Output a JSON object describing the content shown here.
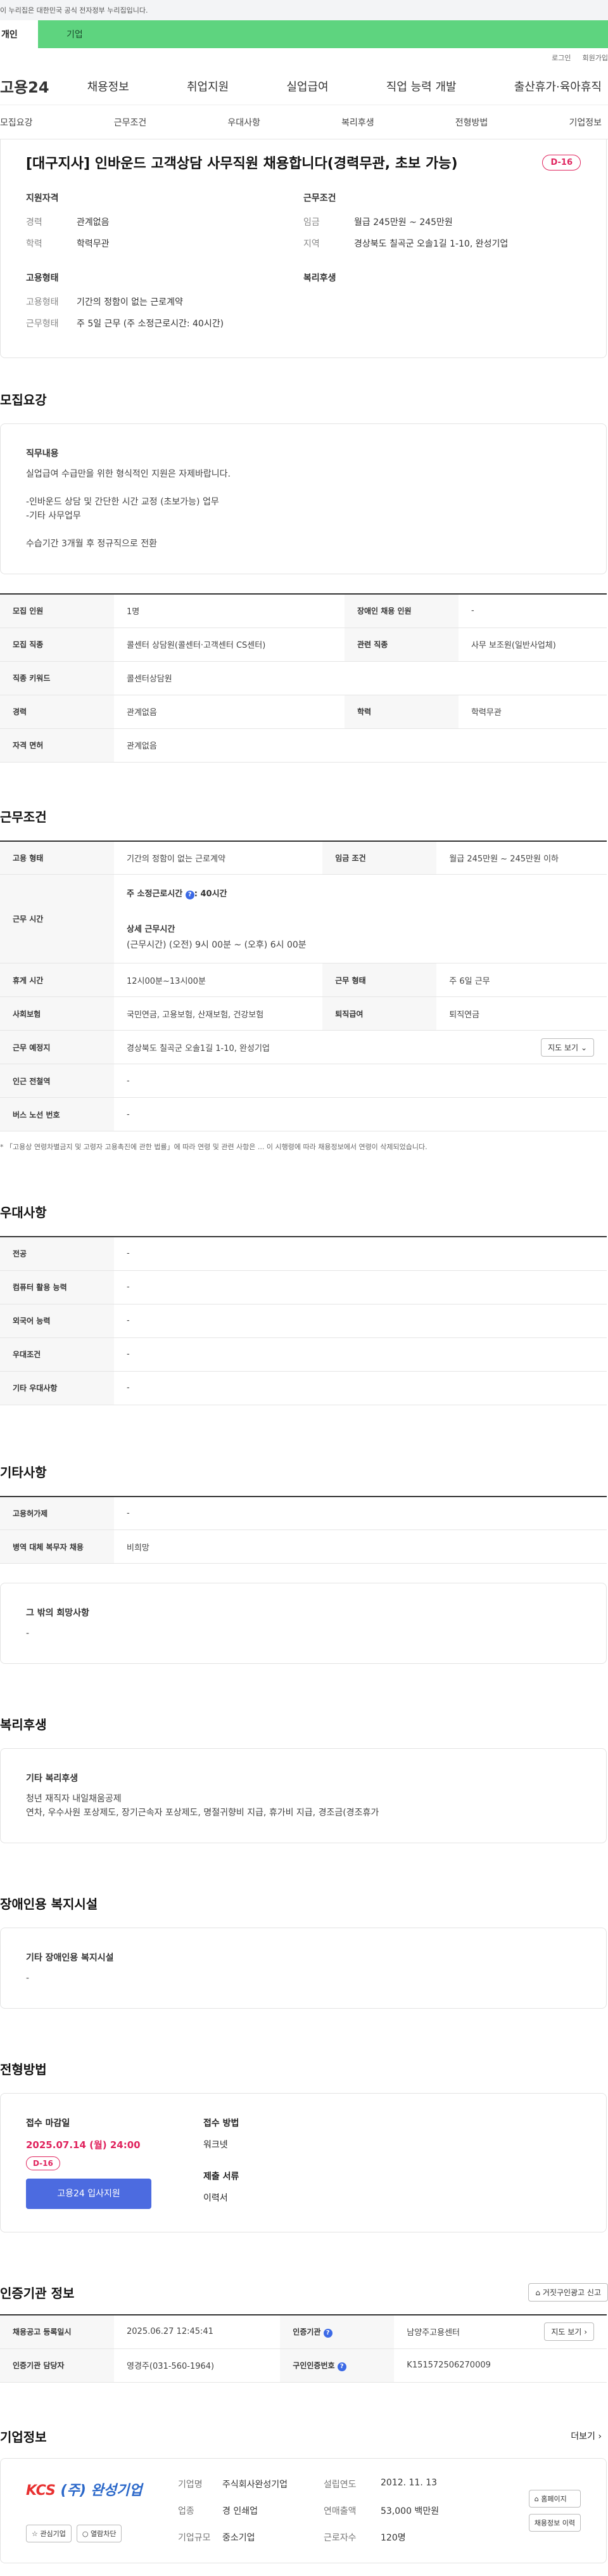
{
  "gov_banner": "이 누리집은 대한민국 공식 전자정부 누리집입니다.",
  "top_tabs": [
    "개인",
    "기업"
  ],
  "util_links": [
    "로그인",
    "회원가입"
  ],
  "logo": "고용24",
  "gnb": [
    "채용정보",
    "취업지원",
    "실업급여",
    "직업 능력 개발",
    "출산휴가·육아휴직"
  ],
  "subnav": [
    "모집요강",
    "근무조건",
    "우대사항",
    "복리후생",
    "전형방법",
    "기업정보"
  ],
  "title_box": {
    "title": "[대구지사] 인바운드 고객상담 사무직원 채용합니다(경력무관, 초보 가능)",
    "dday": "D-16",
    "qual_label": "지원자격",
    "qual": [
      {
        "k": "경력",
        "v": "관계없음"
      },
      {
        "k": "학력",
        "v": "학력무관"
      }
    ],
    "cond_label": "근무조건",
    "cond": [
      {
        "k": "임금",
        "v": "월급 245만원 ~ 245만원"
      },
      {
        "k": "지역",
        "v": "경상북도 칠곡군 오솔1길 1-10, 완성기업"
      }
    ],
    "emp_label": "고용형태",
    "emp": [
      {
        "k": "고용형태",
        "v": "기간의 정함이 없는 근로계약"
      },
      {
        "k": "근무형태",
        "v": "주 5일 근무 (주 소정근로시간: 40시간)"
      }
    ],
    "welfare_label": "복리후생"
  },
  "recruit": {
    "heading": "모집요강",
    "job_label": "직무내용",
    "job_lines": [
      "실업급여 수급만을 위한 형식적인 지원은 자제바랍니다.",
      "",
      "-인바운드 상담 및 간단한 시간 교정 (초보가능) 업무",
      "-기타 사무업무",
      "",
      "수습기간 3개월 후 정규직으로 전환"
    ],
    "rows": [
      [
        "모집 인원",
        "1명",
        "장애인 채용 인원",
        "-"
      ],
      [
        "모집 직종",
        "콜센터 상담원(콜센터·고객센터 CS센터)",
        "관련 직종",
        "사무 보조원(일반사업체)"
      ],
      [
        "직종 키워드",
        "콜센터상담원"
      ],
      [
        "경력",
        "관계없음",
        "학력",
        "학력무관"
      ],
      [
        "자격 면허",
        "관계없음"
      ]
    ]
  },
  "work": {
    "heading": "근무조건",
    "emp_type_k": "고용 형태",
    "emp_type_v": "기간의 정함이 없는 근로계약",
    "wage_k": "임금 조건",
    "wage_v": "월급 245만원 ~ 245만원 이하",
    "hours_k": "근무 시간",
    "hours_title": "주 소정근로시간",
    "hours_val": ": 40시간",
    "detail_title": "상세 근무시간",
    "detail_val": "(근무시간) (오전) 9시 00분 ~ (오후) 6시 00분",
    "break_k": "휴게 시간",
    "break_v": "12시00분~13시00분",
    "form_k": "근무 형태",
    "form_v": "주 6일 근무",
    "ins_k": "사회보험",
    "ins_v": "국민연금, 고용보험, 산재보험, 건강보험",
    "ret_k": "퇴직급여",
    "ret_v": "퇴직연금",
    "place_k": "근무 예정지",
    "place_v": "경상북도 칠곡군 오솔1길 1-10, 완성기업",
    "map_btn": "지도 보기",
    "subway_k": "인근 전철역",
    "subway_v": "-",
    "bus_k": "버스 노선 번호",
    "bus_v": "-",
    "note": "* 「고용상 연령차별금지 및 고령자 고용촉진에 관한 법률」에 따라 연령 및 관련 사항은 ... 이 시행령에 따라 채용정보에서 연령이 삭제되었습니다."
  },
  "pref": {
    "heading": "우대사항",
    "rows": [
      [
        "전공",
        "-"
      ],
      [
        "컴퓨터 활용 능력",
        "-"
      ],
      [
        "외국어 능력",
        "-"
      ],
      [
        "우대조건",
        "-"
      ],
      [
        "기타 우대사항",
        "-"
      ]
    ]
  },
  "etc": {
    "heading": "기타사항",
    "rows": [
      [
        "고용허가제",
        "-"
      ],
      [
        "병역 대체 복무자 채용",
        "비희망"
      ]
    ],
    "other_label": "그 밖의 희망사항",
    "other_val": "-"
  },
  "welfare": {
    "heading": "복리후생",
    "label": "기타 복리후생",
    "line1": "청년 재직자 내일채움공제",
    "line2": "연차, 우수사원 포상제도, 장기근속자 포상제도, 명절귀향비 지급, 휴가비 지급, 경조금(경조휴가"
  },
  "disability": {
    "heading": "장애인용 복지시설",
    "label": "기타 장애인용 복지시설",
    "val": "-"
  },
  "apply": {
    "heading": "전형방법",
    "deadline_label": "접수 마감일",
    "deadline": "2025.07.14 (월) 24:00",
    "dday": "D-16",
    "btn": "고용24 입사지원",
    "method_label": "접수 방법",
    "method": "워크넷",
    "docs_label": "제출 서류",
    "docs": "이력서"
  },
  "cert": {
    "heading": "인증기관 정보",
    "report_btn": "거짓구인광고 신고",
    "reg_date_k": "채용공고 등록일시",
    "reg_date_v": "2025.06.27 12:45:41",
    "org_k": "인증기관",
    "org_v": "남양주고용센터",
    "map_btn": "지도 보기",
    "mgr_k": "인증기관 담당자",
    "mgr_v": "영경주(031-560-1964)",
    "no_k": "구인인증번호",
    "no_v": "K151572506270009"
  },
  "company": {
    "heading": "기업정보",
    "more": "더보기",
    "logo_mark": "KCS",
    "logo_name": "(주) 완성기업",
    "fav_btn": "관심기업",
    "block_btn": "열람차단",
    "info": [
      [
        "기업명",
        "주식회사완성기업",
        "설립연도",
        "2012. 11. 13"
      ],
      [
        "업종",
        "경 인쇄업",
        "연매출액",
        "53,000 백만원"
      ],
      [
        "기업규모",
        "중소기업",
        "근로자수",
        "120명"
      ]
    ],
    "home_btn": "홈페이지",
    "history_btn": "채용정보 이력"
  }
}
